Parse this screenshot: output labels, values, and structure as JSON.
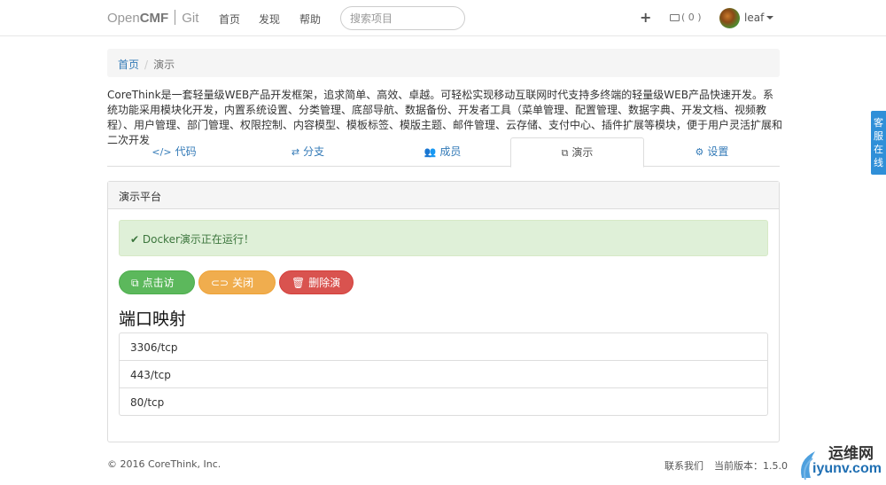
{
  "navbar": {
    "brand_prefix": "Open",
    "brand_bold": "CMF",
    "brand_suffix": "Git",
    "links": [
      "首页",
      "发现",
      "帮助"
    ],
    "search_placeholder": "搜索项目",
    "plus": "+",
    "mail_count": "( 0 )",
    "username": "leaf"
  },
  "breadcrumb": {
    "home": "首页",
    "separator": "/",
    "current": "演示"
  },
  "description": "CoreThink是一套轻量级WEB产品开发框架，追求简单、高效、卓越。可轻松实现移动互联网时代支持多终端的轻量级WEB产品快速开发。系统功能采用模块化开发，内置系统设置、分类管理、底部导航、数据备份、开发者工具（菜单管理、配置管理、数据字典、开发文档、视频教程）、用户管理、部门管理、权限控制、内容模型、模板标签、模版主题、邮件管理、云存储、支付中心、插件扩展等模块，便于用户灵活扩展和二次开发",
  "tabs": [
    {
      "icon": "code-icon",
      "label": "代码"
    },
    {
      "icon": "shuffle-icon",
      "label": "分支"
    },
    {
      "icon": "users-icon",
      "label": "成员"
    },
    {
      "icon": "external-link-icon",
      "label": "演示",
      "active": true
    },
    {
      "icon": "gear-icon",
      "label": "设置"
    }
  ],
  "panel": {
    "title": "演示平台",
    "alert": "Docker演示正在运行！",
    "buttons": {
      "visit": "点击访问",
      "stop": "关闭演示",
      "delete": "删除演示"
    },
    "section_title": "端口映射",
    "ports": [
      "3306/tcp",
      "443/tcp",
      "80/tcp"
    ]
  },
  "footer": {
    "copyright": "© 2016 CoreThink, Inc.",
    "contact": "联系我们",
    "version": "当前版本：1.5.0"
  },
  "side_tab": "客服在线",
  "watermark": {
    "cn": "运维网",
    "url": "iyunv.com"
  },
  "colors": {
    "link": "#337ab7",
    "success": "#5cb85c",
    "warning": "#f0ad4e",
    "danger": "#d9534f",
    "side_tab": "#2f8fd8"
  }
}
